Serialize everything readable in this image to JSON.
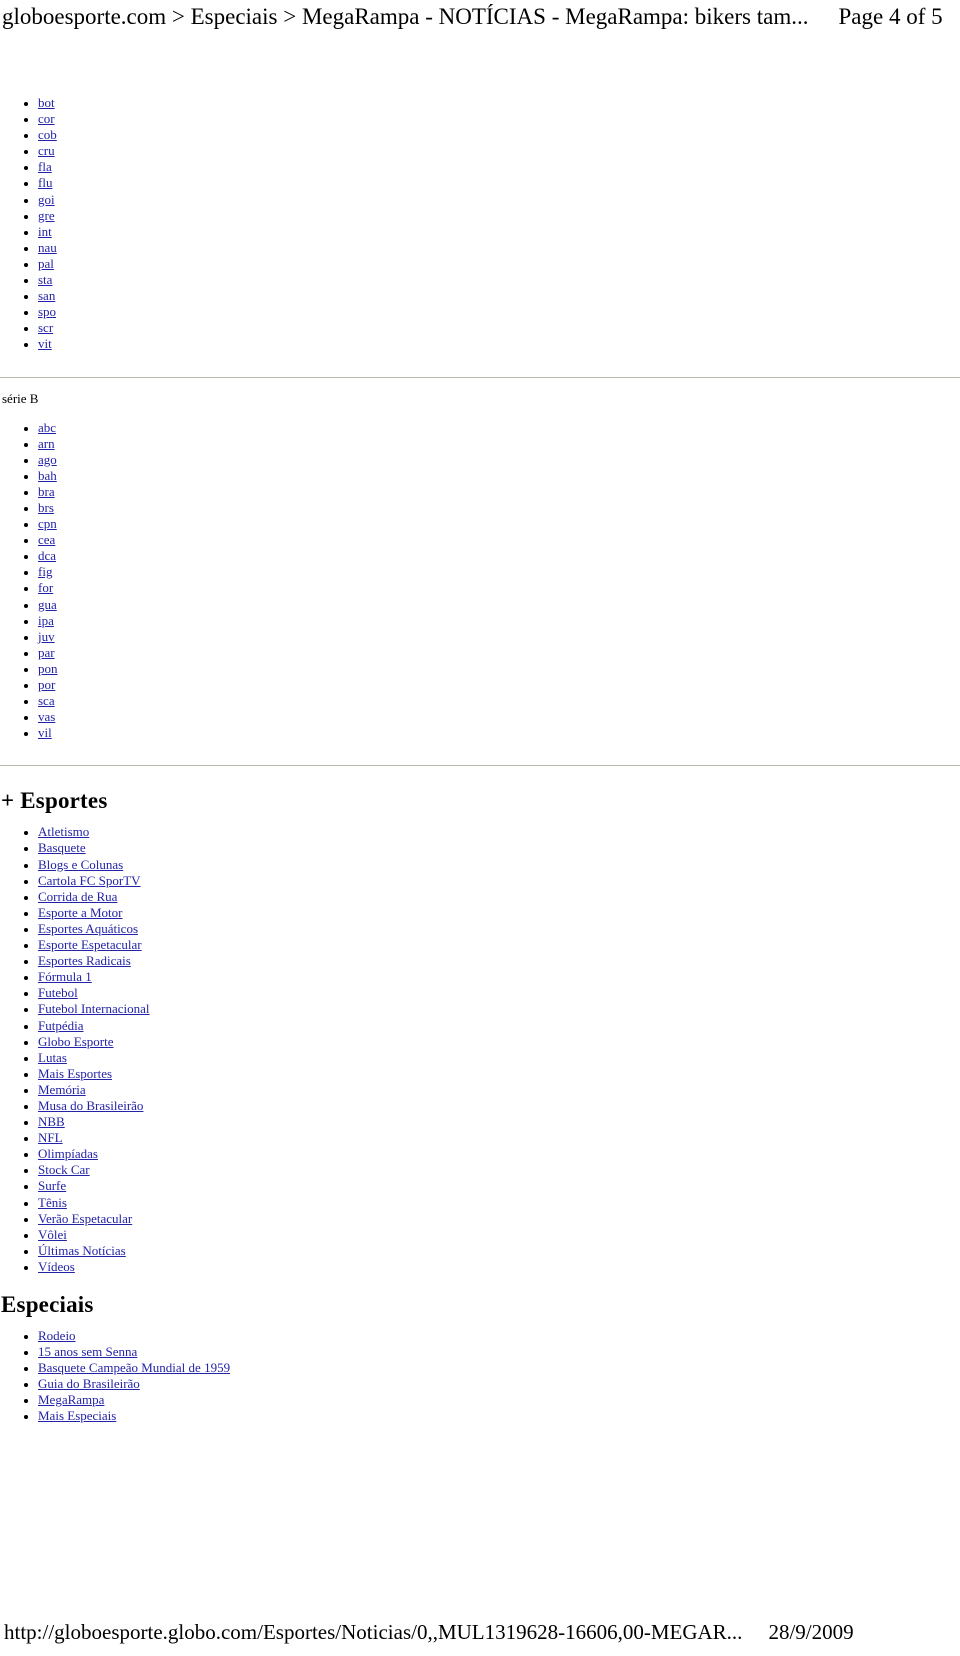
{
  "header": {
    "title": "globoesporte.com > Especiais > MegaRampa - NOTÍCIAS - MegaRampa: bikers tam...",
    "page_label": "Page 4 of 5"
  },
  "footer": {
    "url": "http://globoesporte.globo.com/Esportes/Noticias/0,,MUL1319628-16606,00-MEGAR...",
    "date": "28/9/2009"
  },
  "colors": {
    "link": "#2323a8",
    "text": "#000000",
    "rule": "#b9b9ad",
    "background": "#ffffff"
  },
  "sections": [
    {
      "id": "serie-a-clubs",
      "heading": null,
      "items": [
        "bot",
        "cor",
        "cob",
        "cru",
        "fla",
        "flu",
        "goi",
        "gre",
        "int",
        "nau",
        "pal",
        "sta",
        "san",
        "spo",
        "scr",
        "vit"
      ]
    },
    {
      "id": "serie-b-clubs",
      "heading": "série B",
      "items": [
        "abc",
        "arn",
        "ago",
        "bah",
        "bra",
        "brs",
        "cpn",
        "cea",
        "dca",
        "fig",
        "for",
        "gua",
        "ipa",
        "juv",
        "par",
        "pon",
        "por",
        "sca",
        "vas",
        "vil"
      ]
    },
    {
      "id": "esportes",
      "heading": "+ Esportes",
      "items": [
        "Atletismo",
        "Basquete",
        "Blogs e Colunas",
        "Cartola FC SporTV",
        "Corrida de Rua",
        "Esporte a Motor",
        "Esportes Aquáticos",
        "Esporte Espetacular",
        "Esportes Radicais",
        "Fórmula 1",
        "Futebol",
        "Futebol Internacional",
        "Futpédia",
        "Globo Esporte",
        "Lutas",
        "Mais Esportes",
        "Memória",
        "Musa do Brasileirão",
        "NBB",
        "NFL",
        "Olimpíadas",
        "Stock Car",
        "Surfe",
        "Tênis",
        "Verão Espetacular",
        "Vôlei",
        "Últimas Notícias",
        "Vídeos"
      ]
    },
    {
      "id": "especiais",
      "heading": "Especiais",
      "items": [
        "Rodeio",
        "15 anos sem Senna",
        "Basquete Campeão Mundial de 1959",
        "Guia do Brasileirão",
        "MegaRampa",
        "Mais Especiais"
      ]
    }
  ]
}
